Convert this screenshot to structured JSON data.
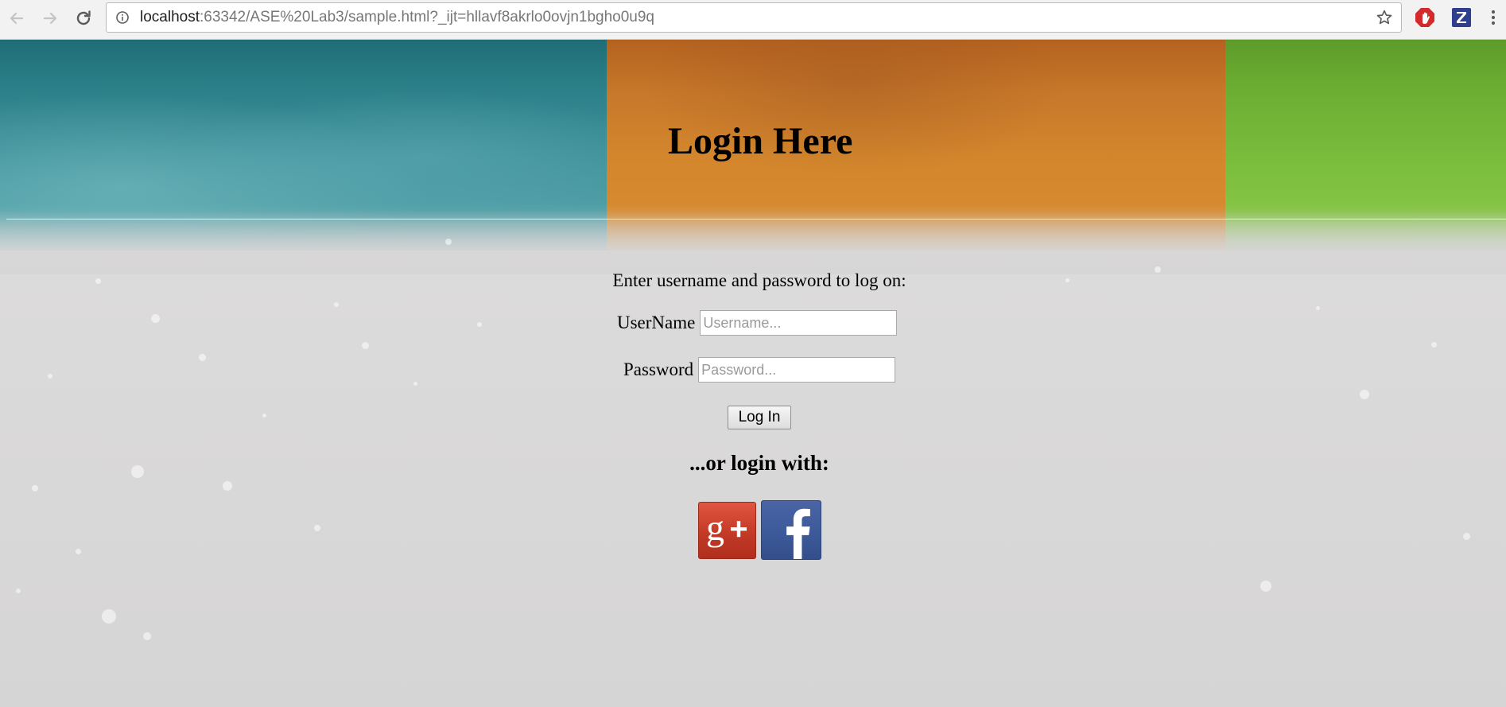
{
  "browser": {
    "url_host": "localhost",
    "url_rest": ":63342/ASE%20Lab3/sample.html?_ijt=hllavf8akrlo0ovjn1bgho0u9q",
    "icons": {
      "back": "back-arrow-icon",
      "forward": "forward-arrow-icon",
      "reload": "reload-icon",
      "info": "info-icon",
      "bookmark": "star-icon",
      "extension_1": "adblock-icon",
      "extension_2": "z-extension-icon",
      "menu": "kebab-menu-icon"
    }
  },
  "header": {
    "title": "Login Here",
    "band_colors": [
      "#2b7f88",
      "#c7782a",
      "#6aac31"
    ]
  },
  "form": {
    "instruction": "Enter username and password to log on:",
    "username_label": "UserName",
    "username_placeholder": "Username...",
    "username_value": "",
    "password_label": "Password",
    "password_placeholder": "Password...",
    "password_value": "",
    "submit_label": "Log In"
  },
  "social": {
    "heading": "...or login with:",
    "providers": [
      {
        "name": "Google+",
        "icon": "google-plus-icon",
        "color": "#c33a27"
      },
      {
        "name": "Facebook",
        "icon": "facebook-icon",
        "color": "#3b5998"
      }
    ]
  }
}
